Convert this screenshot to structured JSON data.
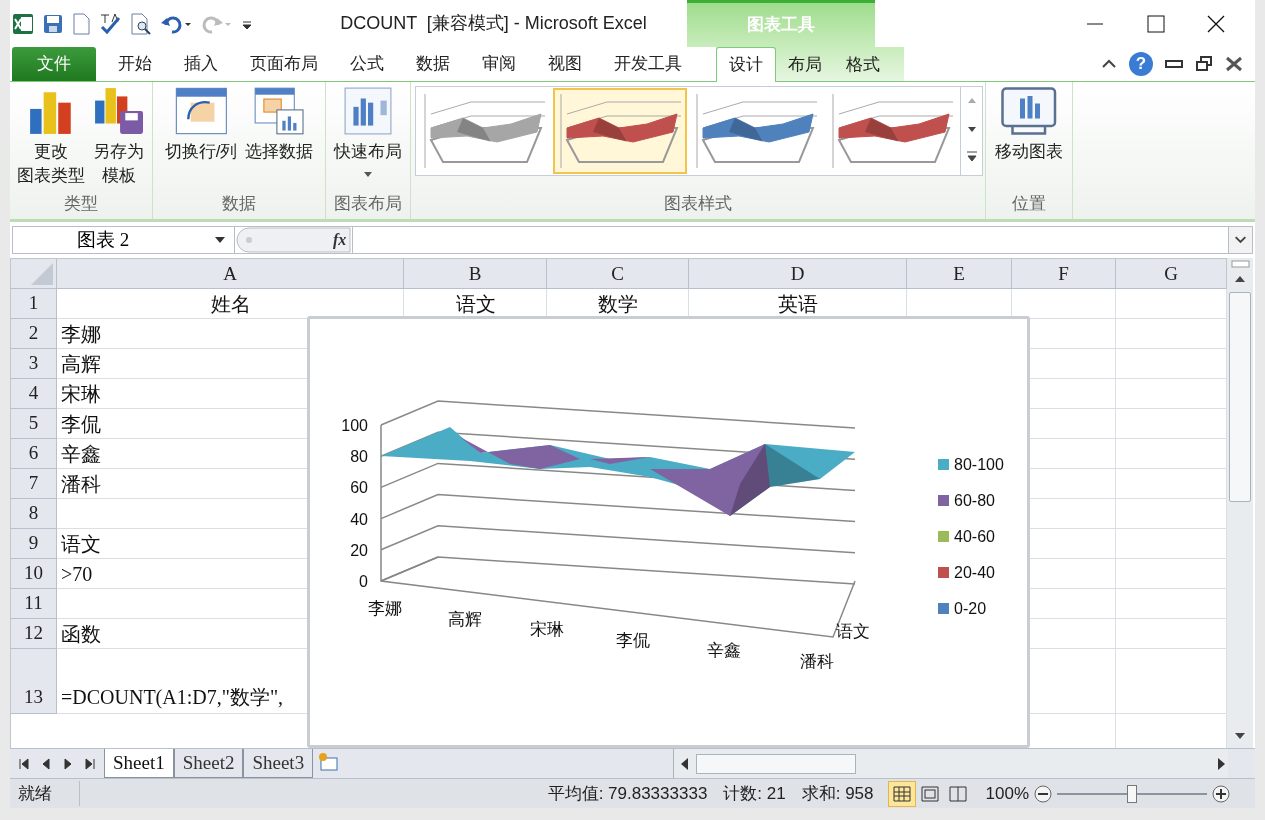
{
  "window": {
    "title": "DCOUNT  [兼容模式] - Microsoft Excel",
    "context_group": "图表工具"
  },
  "menu_tabs": [
    {
      "label": "文件",
      "kind": "file",
      "selected": false
    },
    {
      "label": "开始",
      "kind": "normal",
      "selected": false
    },
    {
      "label": "插入",
      "kind": "normal",
      "selected": false
    },
    {
      "label": "页面布局",
      "kind": "normal",
      "selected": false
    },
    {
      "label": "公式",
      "kind": "normal",
      "selected": false
    },
    {
      "label": "数据",
      "kind": "normal",
      "selected": false
    },
    {
      "label": "审阅",
      "kind": "normal",
      "selected": false
    },
    {
      "label": "视图",
      "kind": "normal",
      "selected": false
    },
    {
      "label": "开发工具",
      "kind": "normal",
      "selected": false
    },
    {
      "label": "设计",
      "kind": "context",
      "selected": true
    },
    {
      "label": "布局",
      "kind": "context",
      "selected": false
    },
    {
      "label": "格式",
      "kind": "context",
      "selected": false
    }
  ],
  "help": "?",
  "ribbon_groups": [
    {
      "label": "类型",
      "buttons": [
        {
          "lines": [
            "更改",
            "图表类型"
          ],
          "kind": "change-type"
        },
        {
          "lines": [
            "另存为",
            "模板"
          ],
          "kind": "save-template"
        }
      ]
    },
    {
      "label": "数据",
      "buttons": [
        {
          "lines": [
            "切换行/列"
          ],
          "kind": "switch"
        },
        {
          "lines": [
            "选择数据"
          ],
          "kind": "select-data"
        }
      ]
    },
    {
      "label": "图表布局",
      "buttons": [
        {
          "lines": [
            "快速布局"
          ],
          "kind": "quick-layout",
          "dropdown": true
        }
      ]
    },
    {
      "label": "图表样式",
      "gallery": [
        {
          "color": "#a6a6a6",
          "selected": false
        },
        {
          "color": "#c0504d",
          "selected": true
        },
        {
          "color": "#4f81bd",
          "selected": false
        },
        {
          "color": "#c0504d",
          "selected": false
        }
      ]
    },
    {
      "label": "位置",
      "buttons": [
        {
          "lines": [
            "移动图表"
          ],
          "kind": "move"
        }
      ]
    }
  ],
  "formula_bar": {
    "name_box": "图表 2",
    "fx": "fx"
  },
  "sheet": {
    "columns": [
      "A",
      "B",
      "C",
      "D",
      "E",
      "F",
      "G"
    ],
    "rows": [
      {
        "number": "1",
        "cells": [
          "姓名",
          "语文",
          "数学",
          "英语"
        ]
      },
      {
        "number": "2",
        "cells": [
          "李娜"
        ]
      },
      {
        "number": "3",
        "cells": [
          "高辉"
        ]
      },
      {
        "number": "4",
        "cells": [
          "宋琳"
        ]
      },
      {
        "number": "5",
        "cells": [
          "李侃"
        ]
      },
      {
        "number": "6",
        "cells": [
          "辛鑫"
        ]
      },
      {
        "number": "7",
        "cells": [
          "潘科"
        ]
      },
      {
        "number": "8"
      },
      {
        "number": "9",
        "cells": [
          "语文"
        ]
      },
      {
        "number": "10",
        "cells": [
          ">70"
        ]
      },
      {
        "number": "11"
      },
      {
        "number": "12",
        "cells": [
          "函数"
        ]
      },
      {
        "number": "13",
        "cells": [
          "=DCOUNT(A1:D7,\"数学\","
        ]
      }
    ]
  },
  "chart": {
    "yticks": [
      "100",
      "80",
      "60",
      "40",
      "20",
      "0"
    ],
    "categories": [
      "李娜",
      "高辉",
      "宋琳",
      "李侃",
      "辛鑫",
      "潘科"
    ],
    "series_axis": [
      "语文"
    ],
    "legend": [
      {
        "label": "80-100",
        "color": "#4bacc6"
      },
      {
        "label": "60-80",
        "color": "#8064a2"
      },
      {
        "label": "40-60",
        "color": "#9bbb59"
      },
      {
        "label": "20-40",
        "color": "#c0504d"
      },
      {
        "label": "0-20",
        "color": "#4f81bd"
      }
    ]
  },
  "sheet_tabs": [
    {
      "label": "Sheet1",
      "selected": true
    },
    {
      "label": "Sheet2",
      "selected": false
    },
    {
      "label": "Sheet3",
      "selected": false
    }
  ],
  "status_bar": {
    "ready": "就绪",
    "average": "平均值: 79.83333333",
    "count": "计数: 21",
    "sum": "求和: 958",
    "zoom": "100%",
    "zoom_slider": {
      "level": 0.5
    },
    "views": [
      {
        "kind": "normal",
        "selected": true
      },
      {
        "kind": "page-layout",
        "selected": false
      },
      {
        "kind": "page-break",
        "selected": false
      }
    ]
  }
}
